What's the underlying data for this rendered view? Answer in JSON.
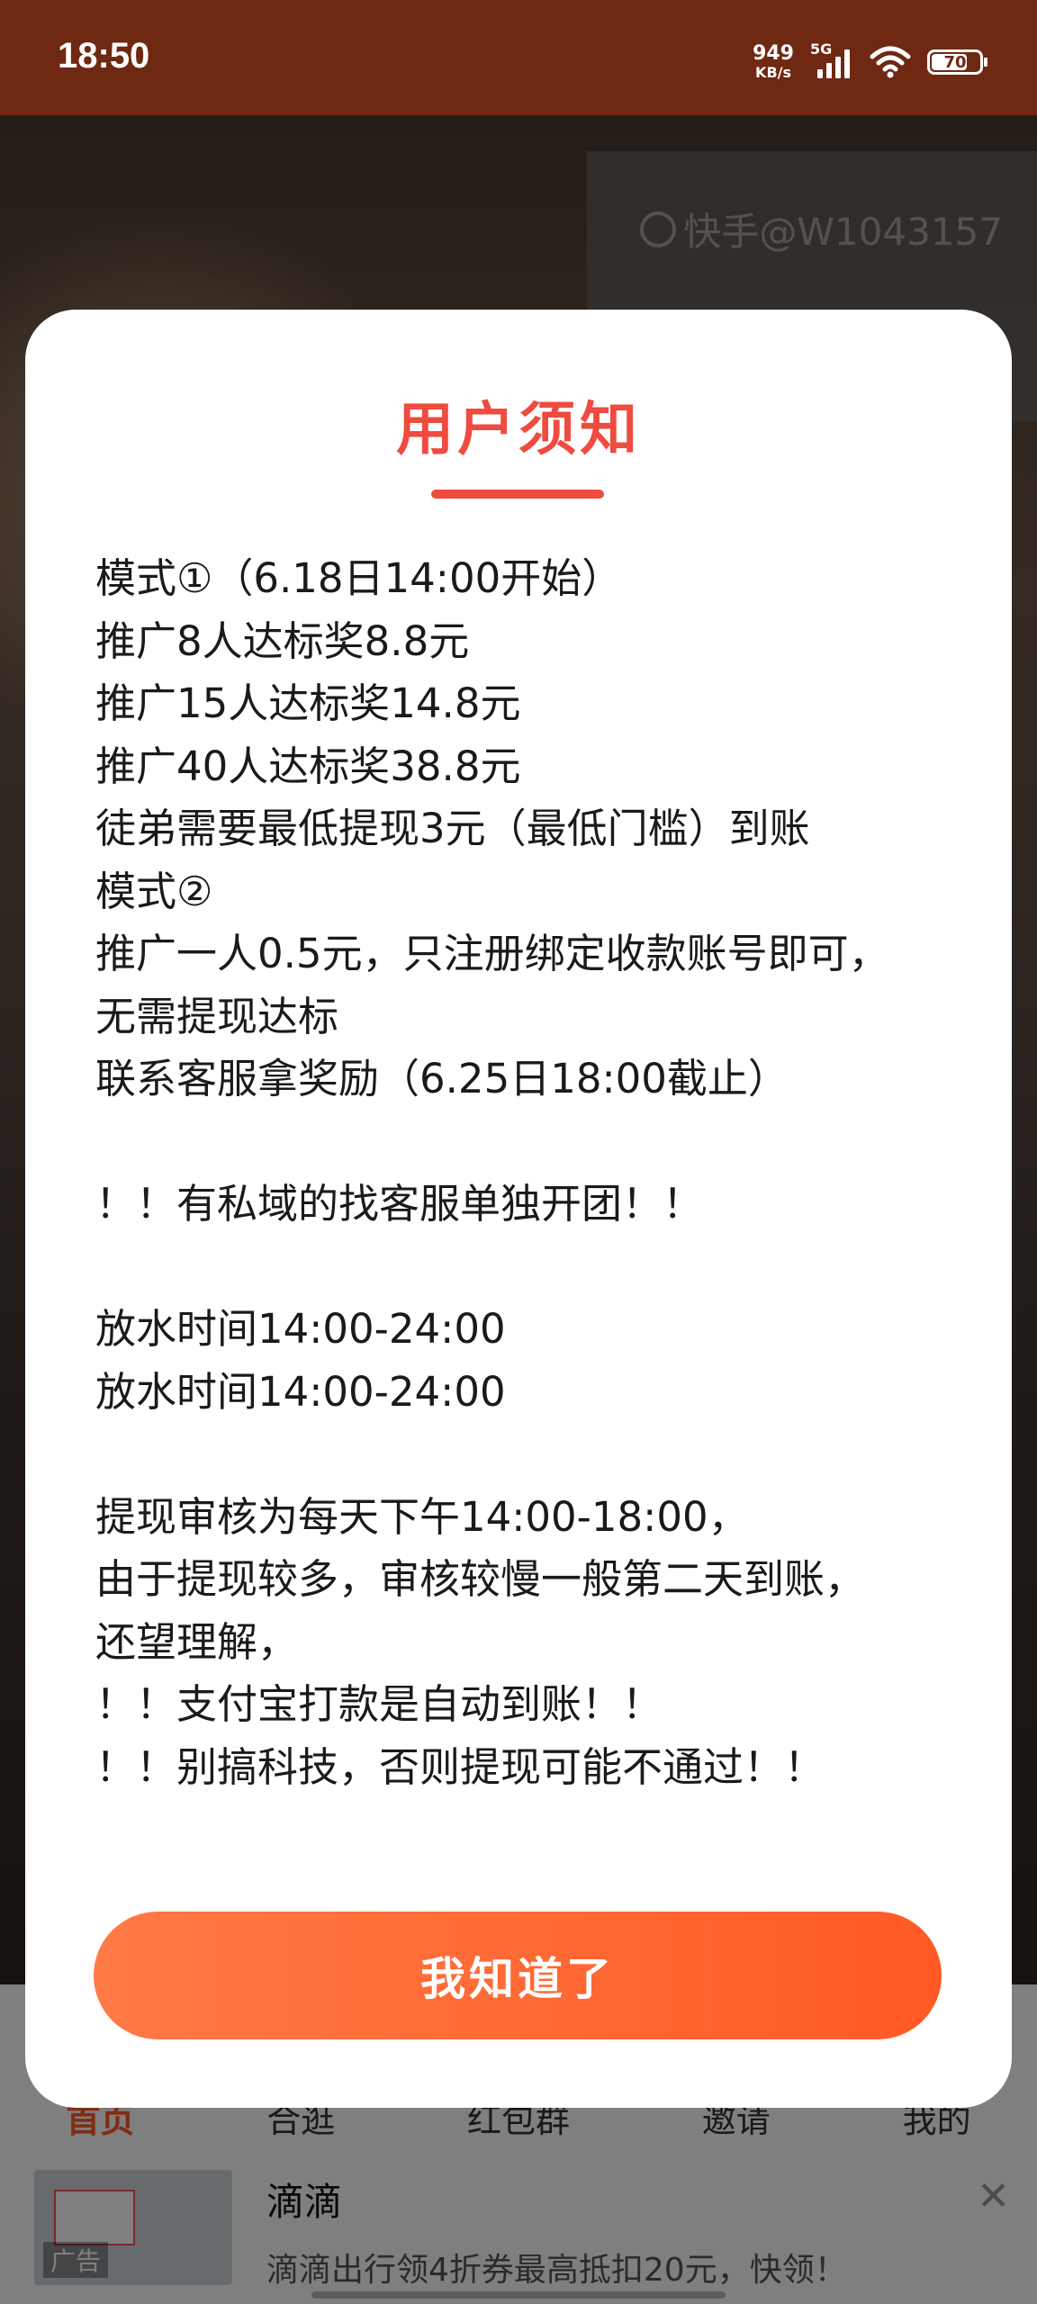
{
  "status_bar": {
    "time": "18:50",
    "net_speed_value": "949",
    "net_speed_unit": "KB/s",
    "network": "5G",
    "battery": "70"
  },
  "watermark": {
    "text": "快手@W1043157"
  },
  "dialog": {
    "title": "用户须知",
    "lines": [
      "模式①（6.18日14:00开始）",
      "推广8人达标奖8.8元",
      "推广15人达标奖14.8元",
      "推广40人达标奖38.8元",
      "徒弟需要最低提现3元（最低门槛）到账",
      "模式②",
      "推广一人0.5元，只注册绑定收款账号即可，",
      "无需提现达标",
      "联系客服拿奖励（6.25日18:00截止）",
      "",
      "！！有私域的找客服单独开团！！",
      "",
      "放水时间14:00-24:00",
      "放水时间14:00-24:00",
      "",
      "提现审核为每天下午14:00-18:00，",
      "由于提现较多，审核较慢一般第二天到账，",
      "还望理解，",
      "！！支付宝打款是自动到账！！",
      "！！别搞科技，否则提现可能不通过！！"
    ],
    "confirm_label": "我知道了"
  },
  "bottom_nav": {
    "items": [
      "首页",
      "合逛",
      "红包群",
      "邀请",
      "我的"
    ]
  },
  "ad": {
    "thumb_label": "广告",
    "title": "滴滴",
    "desc": "滴滴出行领4折券最高抵扣20元，快领！"
  },
  "colors": {
    "accent": "#ef4b3f",
    "button_start": "#ff7a45",
    "button_end": "#ff5a25",
    "status_bar": "#6f2812"
  }
}
